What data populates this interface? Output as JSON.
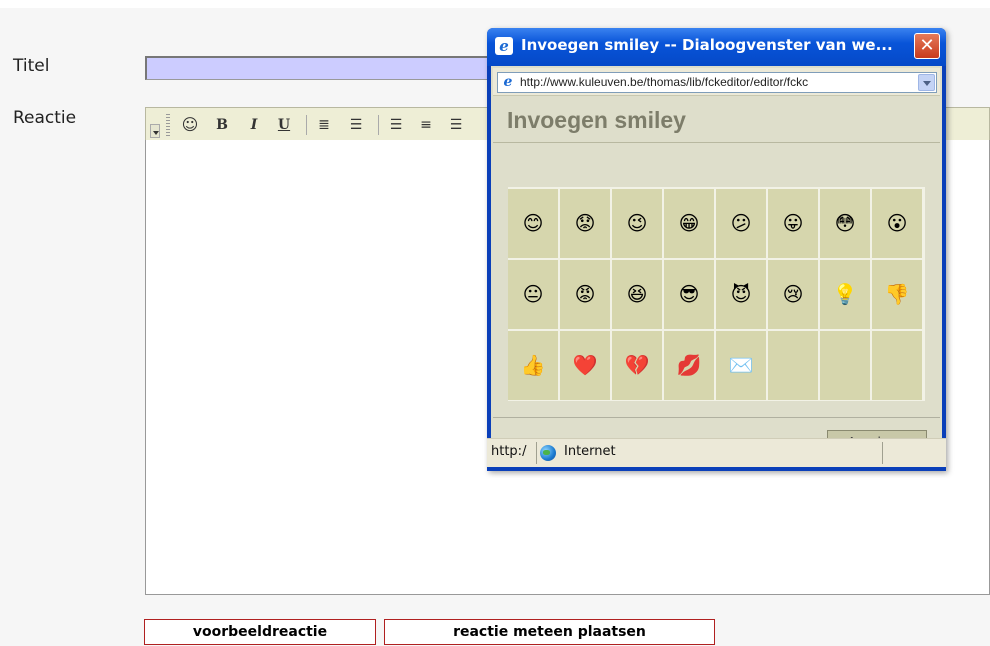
{
  "form": {
    "title_label": "Titel",
    "title_value": "",
    "reaction_label": "Reactie",
    "buttons": {
      "preview": "voorbeeldreactie",
      "post": "reactie meteen plaatsen"
    }
  },
  "toolbar": {
    "items": [
      {
        "name": "smiley-icon",
        "glyph": "☺"
      },
      {
        "name": "bold-button",
        "glyph": "B"
      },
      {
        "name": "italic-button",
        "glyph": "I"
      },
      {
        "name": "underline-button",
        "glyph": "U"
      },
      {
        "name": "ordered-list-icon",
        "glyph": "≣"
      },
      {
        "name": "unordered-list-icon",
        "glyph": "☰"
      },
      {
        "name": "align-left-icon",
        "glyph": "☰"
      },
      {
        "name": "align-center-icon",
        "glyph": "≡"
      },
      {
        "name": "align-right-icon",
        "glyph": "☰"
      }
    ]
  },
  "dialog": {
    "title": "Invoegen smiley -- Dialoogvenster van we...",
    "close_glyph": "✕",
    "address": "http://www.kuleuven.be/thomas/lib/fckeditor/editor/fckc",
    "heading": "Invoegen smiley",
    "cancel_label": "Annuleren",
    "status_text": "http:/",
    "status_zone": "Internet",
    "smileys": [
      [
        "😊",
        "😟",
        "😉",
        "😁",
        "😕",
        "😛",
        "😳",
        "😮"
      ],
      [
        "😐",
        "😡",
        "😆",
        "😎",
        "😈",
        "😢",
        "💡",
        "👎"
      ],
      [
        "👍",
        "❤️",
        "💔",
        "💋",
        "✉️",
        "",
        "",
        ""
      ]
    ]
  }
}
